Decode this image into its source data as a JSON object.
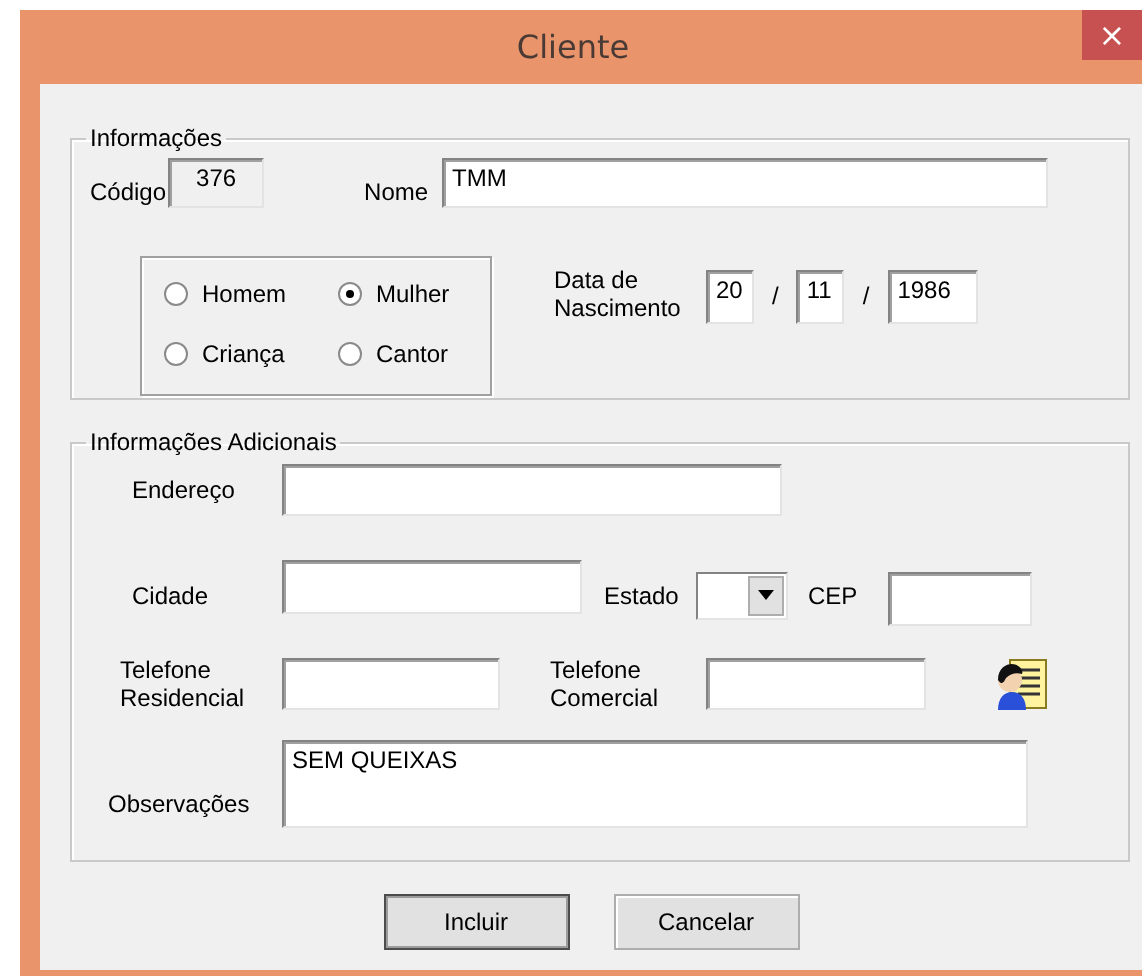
{
  "window": {
    "title": "Cliente",
    "close_button": "×"
  },
  "informacoes": {
    "legend": "Informações",
    "codigo": {
      "label": "Código",
      "value": "376",
      "disabled": true
    },
    "nome": {
      "label": "Nome",
      "value": "TMM"
    },
    "gender_options": [
      {
        "label": "Homem",
        "selected": false
      },
      {
        "label": "Mulher",
        "selected": true
      },
      {
        "label": "Criança",
        "selected": false
      },
      {
        "label": "Cantor",
        "selected": false
      }
    ],
    "data_nascimento": {
      "label": "Data de Nascimento",
      "day": "20",
      "month": "11",
      "year": "1986",
      "separators": [
        "/",
        "/"
      ]
    }
  },
  "informacoes_adicionais": {
    "legend": "Informações Adicionais",
    "endereco": {
      "label": "Endereço"
    },
    "cidade": {
      "label": "Cidade"
    },
    "estado": {
      "label": "Estado"
    },
    "cep": {
      "label": "CEP"
    },
    "telefone_residencial": {
      "label": "Telefone Residencial"
    },
    "telefone_comercial": {
      "label": "Telefone Comercial"
    },
    "observacoes": {
      "label": "Observações",
      "value": "SEM QUEIXAS"
    }
  },
  "buttons": [
    "Incluir",
    "Cancelar"
  ]
}
